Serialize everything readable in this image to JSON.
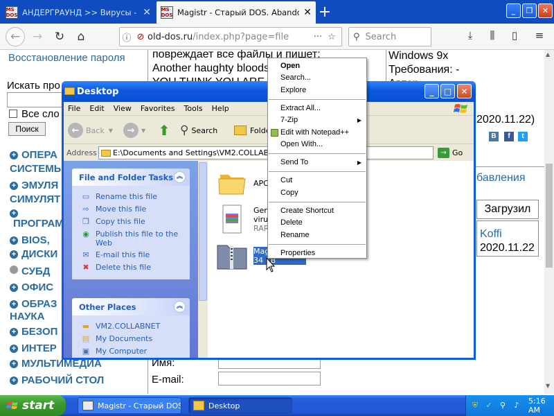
{
  "browser": {
    "tabs": [
      {
        "title": "АНДЕРГРАУНД >> Вирусы - Ст",
        "active": false
      },
      {
        "title": "Magistr - Старый DOS. Abandonwa",
        "active": true
      }
    ],
    "url_domain": "old-dos.ru",
    "url_path": "/index.php?page=file",
    "search_placeholder": "Search"
  },
  "webpage": {
    "password_recovery": "Восстановление пароля",
    "search_label": "Искать про",
    "all_words": "Все сло",
    "search_button": "Поиск",
    "text_line1": "повреждает все файлы и пишет:",
    "text_line2": "Another haughty bloods",
    "text_line3": "YOU THINK YOU ARE",
    "right_line1": "Windows 9x",
    "right_line2": "Требования: -",
    "right_line3": "Автор",
    "date1": "2020.11.22)",
    "added_label": "бавления",
    "upload_label": "Загрузил",
    "uploader": "Koffi",
    "date2": "2020.11.22",
    "name_label": "Имя:",
    "email_label": "E-mail:",
    "menu": [
      {
        "label": "ОПЕРА",
        "bullet": "+"
      },
      {
        "label": "СИСТЕМЫ",
        "bullet": ""
      },
      {
        "label": "ЭМУЛЯ",
        "bullet": "+"
      },
      {
        "label": "СИМУЛЯТ",
        "bullet": ""
      },
      {
        "label": "",
        "bullet": "+"
      },
      {
        "label": "ПРОГРАМ",
        "bullet": ""
      },
      {
        "label": "BIOS, ",
        "bullet": "+"
      },
      {
        "label": "ДИСКИ",
        "bullet": "+"
      },
      {
        "label": "СУБД",
        "bullet": "o"
      },
      {
        "label": "ОФИС",
        "bullet": "+"
      },
      {
        "label": "ОБРАЗ",
        "bullet": "+"
      },
      {
        "label": "НАУКА",
        "bullet": ""
      },
      {
        "label": "БЕЗОП",
        "bullet": "+"
      },
      {
        "label": "ИНТЕР",
        "bullet": "+"
      },
      {
        "label": "МУЛЬТИМЕДИА",
        "bullet": "+"
      },
      {
        "label": "РАБОЧИЙ СТОЛ",
        "bullet": "+"
      }
    ],
    "social": [
      "В",
      "f",
      "t"
    ]
  },
  "explorer": {
    "title": "Desktop",
    "menubar": [
      "File",
      "Edit",
      "View",
      "Favorites",
      "Tools",
      "Help"
    ],
    "toolbar": {
      "back": "Back",
      "search": "Search",
      "folders": "Folde"
    },
    "address_label": "Address",
    "address_value": "E:\\Documents and Settings\\VM2.COLLABNET\\D",
    "go_label": "Go",
    "file_tasks_header": "File and Folder Tasks",
    "file_tasks": [
      {
        "label": "Rename this file",
        "icon": "rename-icon"
      },
      {
        "label": "Move this file",
        "icon": "move-icon"
      },
      {
        "label": "Copy this file",
        "icon": "copy-icon"
      },
      {
        "label": "Publish this file to the Web",
        "icon": "web-publish-icon"
      },
      {
        "label": "E-mail this file",
        "icon": "email-icon"
      },
      {
        "label": "Delete this file",
        "icon": "delete-icon"
      }
    ],
    "other_places_header": "Other Places",
    "other_places": [
      {
        "label": "VM2.COLLABNET",
        "icon": "folder-icon"
      },
      {
        "label": "My Documents",
        "icon": "my-documents-icon"
      },
      {
        "label": "My Computer",
        "icon": "my-computer-icon"
      }
    ],
    "files": [
      {
        "name": "APOK",
        "sub": "",
        "icon": "folder-icon"
      },
      {
        "name": "Gene",
        "name2": "virus",
        "sub": "RAR",
        "icon": "rar-archive-icon"
      },
      {
        "name": "Magis",
        "sub": "34 KB",
        "icon": "zip-archive-icon",
        "selected": true
      }
    ]
  },
  "context_menu": {
    "items": [
      {
        "label": "Open",
        "bold": true
      },
      {
        "label": "Search..."
      },
      {
        "label": "Explore"
      },
      {
        "sep": true
      },
      {
        "label": "Extract All..."
      },
      {
        "label": "7-Zip",
        "submenu": true
      },
      {
        "label": "Edit with Notepad++",
        "icon": true
      },
      {
        "label": "Open With..."
      },
      {
        "sep": true
      },
      {
        "label": "Send To",
        "submenu": true
      },
      {
        "sep": true
      },
      {
        "label": "Cut"
      },
      {
        "label": "Copy"
      },
      {
        "sep": true
      },
      {
        "label": "Create Shortcut"
      },
      {
        "label": "Delete"
      },
      {
        "label": "Rename"
      },
      {
        "sep": true
      },
      {
        "label": "Properties"
      }
    ]
  },
  "taskbar": {
    "start_label": "start",
    "items": [
      {
        "label": "Magistr - Старый DOS..."
      },
      {
        "label": "Desktop"
      }
    ],
    "clock": "5:16 AM"
  }
}
